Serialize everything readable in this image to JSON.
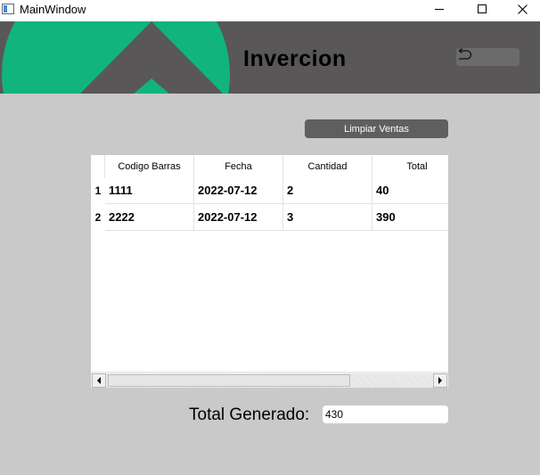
{
  "window": {
    "title": "MainWindow",
    "minimize": "—",
    "maximize": "☐",
    "close": "✕"
  },
  "header": {
    "title": "Invercion",
    "colors": {
      "banner": "#595757",
      "accent": "#12b47e"
    }
  },
  "actions": {
    "clear_label": "Limpiar Ventas",
    "back_icon": "undo-arrow-icon"
  },
  "table": {
    "columns": [
      "Codigo Barras",
      "Fecha",
      "Cantidad",
      "Total"
    ],
    "rows": [
      {
        "index": "1",
        "cells": [
          "1111",
          "2022-07-12",
          "2",
          "40"
        ]
      },
      {
        "index": "2",
        "cells": [
          "2222",
          "2022-07-12",
          "3",
          "390"
        ]
      }
    ]
  },
  "summary": {
    "label": "Total Generado:",
    "value": "430"
  }
}
